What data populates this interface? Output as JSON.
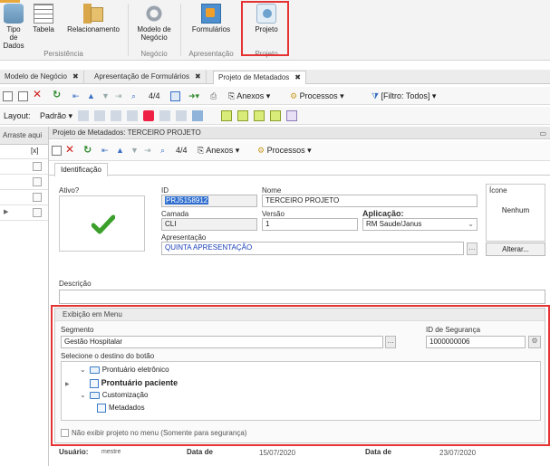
{
  "ribbon": {
    "buttons": [
      {
        "label": "Tipo de Dados"
      },
      {
        "label": "Tabela"
      },
      {
        "label": "Relacionamento"
      },
      {
        "label": "Modelo de Negócio"
      },
      {
        "label": "Formulários"
      },
      {
        "label": "Projeto"
      }
    ],
    "groups": [
      "Persistência",
      "Negócio",
      "Apresentação",
      "Projeto"
    ]
  },
  "doc_tabs": [
    {
      "label": "Modelo de Negócio",
      "close": "✖"
    },
    {
      "label": "Apresentação de Formulários",
      "close": "✖"
    },
    {
      "label": "Projeto de Metadados",
      "close": "✖"
    }
  ],
  "toolbar": {
    "count": "4/4",
    "anexos": "Anexos",
    "processos": "Processos",
    "filtro": "[Filtro: Todos]"
  },
  "layout_bar": {
    "label": "Layout:",
    "value": "Padrão"
  },
  "left_grid": {
    "header": "Arraste aqui",
    "col": "[x]",
    "rows": 5
  },
  "dialog": {
    "title": "Projeto de Metadados: TERCEIRO PROJETO",
    "toolbar": {
      "count": "4/4",
      "anexos": "Anexos",
      "processos": "Processos"
    },
    "tab": "Identificação",
    "fields": {
      "ativo_label": "Ativo?",
      "id_label": "ID",
      "id_value": "PRJ5158912",
      "nome_label": "Nome",
      "nome_value": "TERCEIRO PROJETO",
      "camada_label": "Camada",
      "camada_value": "CLI",
      "versao_label": "Versão",
      "versao_value": "1",
      "aplicacao_label": "Aplicação:",
      "aplicacao_value": "RM Saude/Janus",
      "apresentacao_label": "Apresentação",
      "apresentacao_value": "QUINTA APRESENTAÇÃO",
      "icone_label": "Ícone",
      "icone_value": "Nenhum",
      "alterar": "Alterar...",
      "descricao_label": "Descrição",
      "descricao_value": ""
    },
    "menu": {
      "legend": "Exibição em Menu",
      "segmento_label": "Segmento",
      "segmento_value": "Gestão Hospitalar",
      "seguranca_label": "ID de Segurança",
      "seguranca_value": "1000000006",
      "destino_label": "Selecione o destino do botão",
      "tree": [
        {
          "label": "Prontuário eletrônico",
          "level": 0,
          "type": "folder",
          "expanded": true
        },
        {
          "label": "Prontuário paciente",
          "level": 1,
          "type": "page",
          "bold": true
        },
        {
          "label": "Customização",
          "level": 0,
          "type": "folder",
          "expanded": true
        },
        {
          "label": "Metadados",
          "level": 1,
          "type": "page",
          "bold": false
        }
      ],
      "nao_exibir": "Não exibir projeto no menu (Somente para segurança)"
    },
    "footer": {
      "usuario_label": "Usuário:",
      "usuario_value": "mestre",
      "data1_label": "Data de",
      "data1_value": "15/07/2020",
      "data2_label": "Data de",
      "data2_value": "23/07/2020"
    }
  },
  "colors": {
    "highlight": "#e53333",
    "accent_blue": "#1a3fb8",
    "check_green": "#3aa02a"
  }
}
